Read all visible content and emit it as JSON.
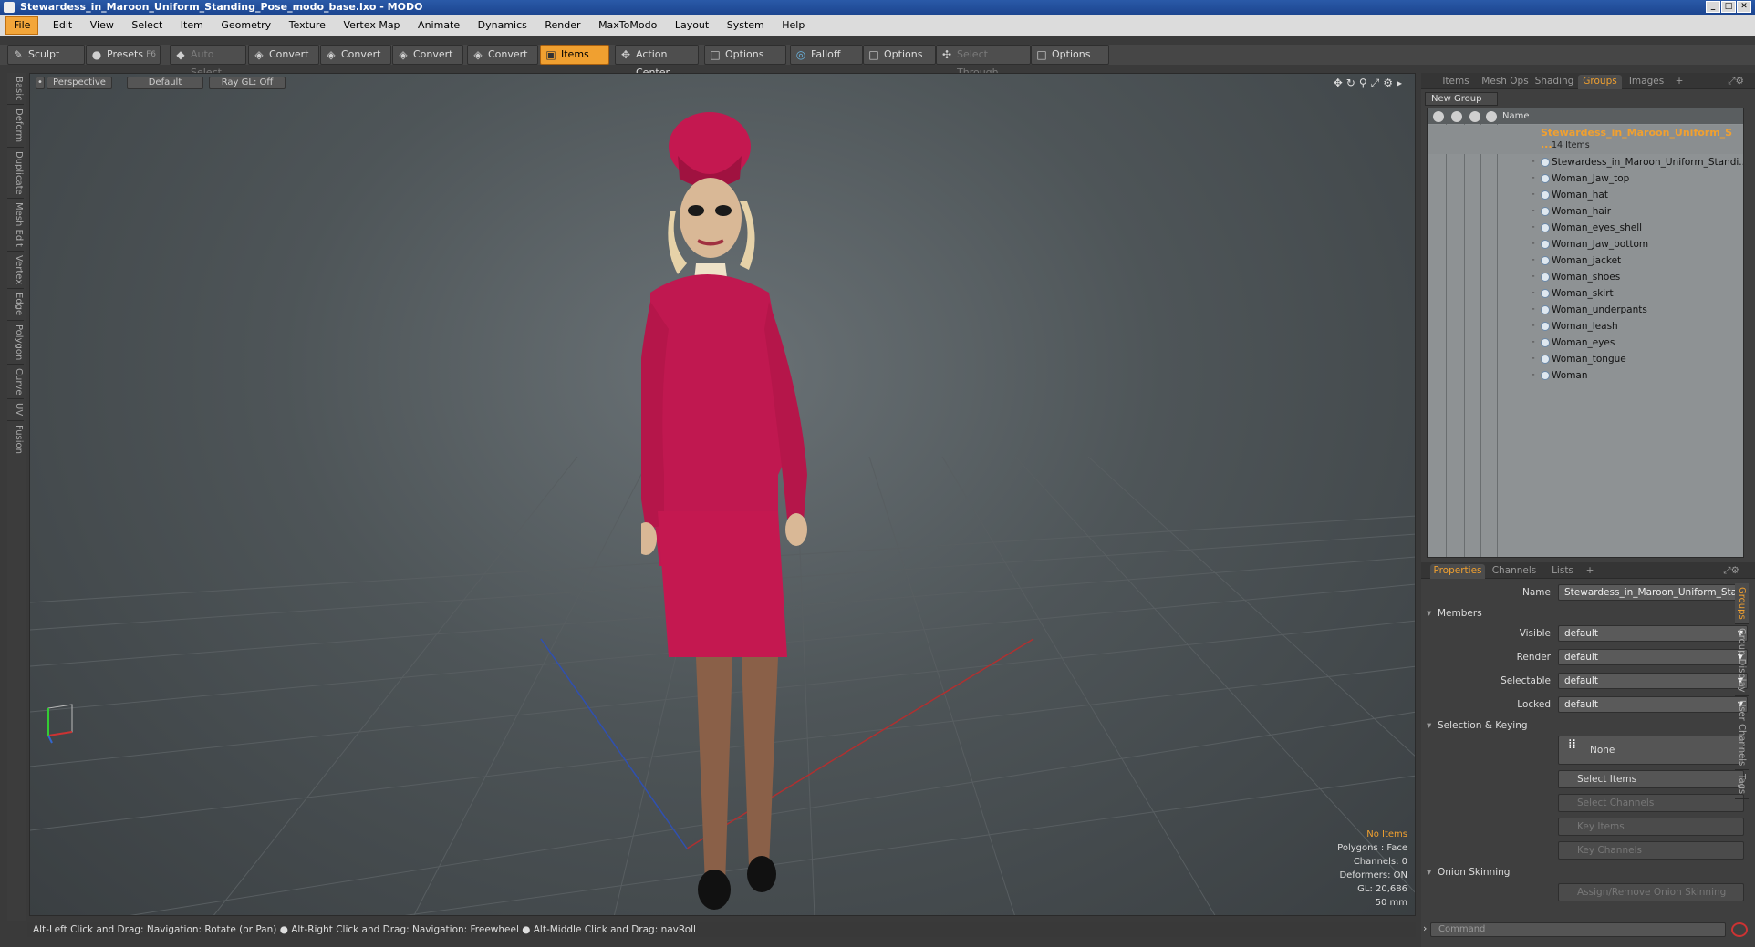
{
  "window": {
    "title": "Stewardess_in_Maroon_Uniform_Standing_Pose_modo_base.lxo - MODO"
  },
  "menu": [
    "File",
    "Edit",
    "View",
    "Select",
    "Item",
    "Geometry",
    "Texture",
    "Vertex Map",
    "Animate",
    "Dynamics",
    "Render",
    "MaxToModo",
    "Layout",
    "System",
    "Help"
  ],
  "toolbar": {
    "sculpt": "Sculpt",
    "presets": "Presets",
    "presets_key": "F6",
    "auto_select": "Auto Select",
    "convert1": "Convert",
    "convert2": "Convert",
    "convert3": "Convert",
    "convert4": "Convert",
    "items": "Items",
    "action_center": "Action Center",
    "options1": "Options",
    "falloff": "Falloff",
    "options2": "Options",
    "select_through": "Select Through",
    "options3": "Options"
  },
  "left_tabs": [
    "Basic",
    "Deform",
    "Duplicate",
    "Mesh Edit",
    "Vertex",
    "Edge",
    "Polygon",
    "Curve",
    "UV",
    "Fusion"
  ],
  "viewport": {
    "view": "Perspective",
    "style": "Default",
    "raygl": "Ray GL: Off",
    "stats": {
      "items": "No Items",
      "polygons": "Polygons : Face",
      "channels": "Channels: 0",
      "deformers": "Deformers: ON",
      "gl": "GL: 20,686",
      "unit": "50 mm"
    }
  },
  "status_bar": "Alt-Left Click and Drag: Navigation: Rotate (or Pan) ● Alt-Right Click and Drag: Navigation: Freewheel ● Alt-Middle Click and Drag: navRoll",
  "right_tabs": [
    "Items",
    "Mesh Ops",
    "Shading",
    "Groups",
    "Images"
  ],
  "groups": {
    "new_group": "New Group",
    "name_col": "Name",
    "root": "Stewardess_in_Maroon_Uniform_S ...",
    "root_count": "14 Items",
    "children": [
      "Stewardess_in_Maroon_Uniform_Standi...",
      "Woman_Jaw_top",
      "Woman_hat",
      "Woman_hair",
      "Woman_eyes_shell",
      "Woman_Jaw_bottom",
      "Woman_jacket",
      "Woman_shoes",
      "Woman_skirt",
      "Woman_underpants",
      "Woman_leash",
      "Woman_eyes",
      "Woman_tongue",
      "Woman"
    ]
  },
  "props_tabs": [
    "Properties",
    "Channels",
    "Lists"
  ],
  "properties": {
    "name_label": "Name",
    "name_value": "Stewardess_in_Maroon_Uniform_Standir",
    "members": "Members",
    "visible_label": "Visible",
    "visible_value": "default",
    "render_label": "Render",
    "render_value": "default",
    "selectable_label": "Selectable",
    "selectable_value": "default",
    "locked_label": "Locked",
    "locked_value": "default",
    "sel_keying": "Selection & Keying",
    "none": "None",
    "select_items": "Select Items",
    "select_channels": "Select Channels",
    "key_items": "Key Items",
    "key_channels": "Key Channels",
    "onion": "Onion Skinning",
    "assign_onion": "Assign/Remove Onion Skinning"
  },
  "side_vtabs": [
    "Groups",
    "Group Display",
    "User Channels",
    "Tags"
  ],
  "command": {
    "placeholder": "Command"
  }
}
